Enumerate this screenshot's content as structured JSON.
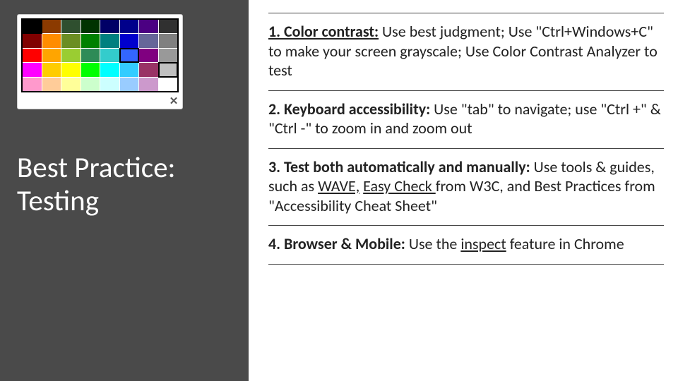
{
  "sidebar": {
    "title_line1": "Best Practice:",
    "title_line2": "Testing",
    "palette": {
      "close_glyph": "✕",
      "rows": [
        [
          "#000000",
          "#8b3a00",
          "#2f4f2f",
          "#003300",
          "#000066",
          "#00008b",
          "#4b0082",
          "#303030"
        ],
        [
          "#800000",
          "#ff8c00",
          "#6b8e23",
          "#008000",
          "#008080",
          "#0000cd",
          "#666699",
          "#808080"
        ],
        [
          "#ff0000",
          "#ffa500",
          "#9acd32",
          "#2e8b57",
          "#33cccc",
          "#3366ff",
          "#800080",
          "#999999"
        ],
        [
          "#ff00ff",
          "#ffcc00",
          "#ffff00",
          "#00ff00",
          "#00ffff",
          "#33ccff",
          "#993366",
          "#c0c0c0"
        ],
        [
          "#ff99cc",
          "#ffcc99",
          "#ffff99",
          "#ccffcc",
          "#ccffff",
          "#99ccff",
          "#cc99cc",
          "#ffffff"
        ]
      ],
      "selected": [
        [
          0,
          0
        ],
        [
          2,
          5
        ],
        [
          3,
          7
        ]
      ]
    }
  },
  "items": [
    {
      "lead": "1. Color contrast:",
      "lead_underline": true,
      "parts": [
        {
          "t": " Use best judgment; Use \"Ctrl+Windows+C\" to make your screen grayscale; Use Color Contrast Analyzer to test"
        }
      ]
    },
    {
      "lead": "2. Keyboard accessibility:",
      "lead_underline": false,
      "parts": [
        {
          "t": " Use \"tab\" to navigate; use \"Ctrl +\" & \"Ctrl -\" to zoom in and zoom out"
        }
      ]
    },
    {
      "lead": "3. Test both automatically and manually:",
      "lead_underline": false,
      "parts": [
        {
          "t": " Use tools & guides, such as "
        },
        {
          "t": "WAVE,",
          "link": true
        },
        {
          "t": " "
        },
        {
          "t": "Easy Check ",
          "link": true
        },
        {
          "t": "from W3C, and Best Practices from \"Accessibility Cheat Sheet\""
        }
      ]
    },
    {
      "lead": "4. Browser & Mobile:",
      "lead_underline": false,
      "parts": [
        {
          "t": " Use the "
        },
        {
          "t": "inspect",
          "link": true
        },
        {
          "t": " feature in Chrome"
        }
      ]
    }
  ]
}
